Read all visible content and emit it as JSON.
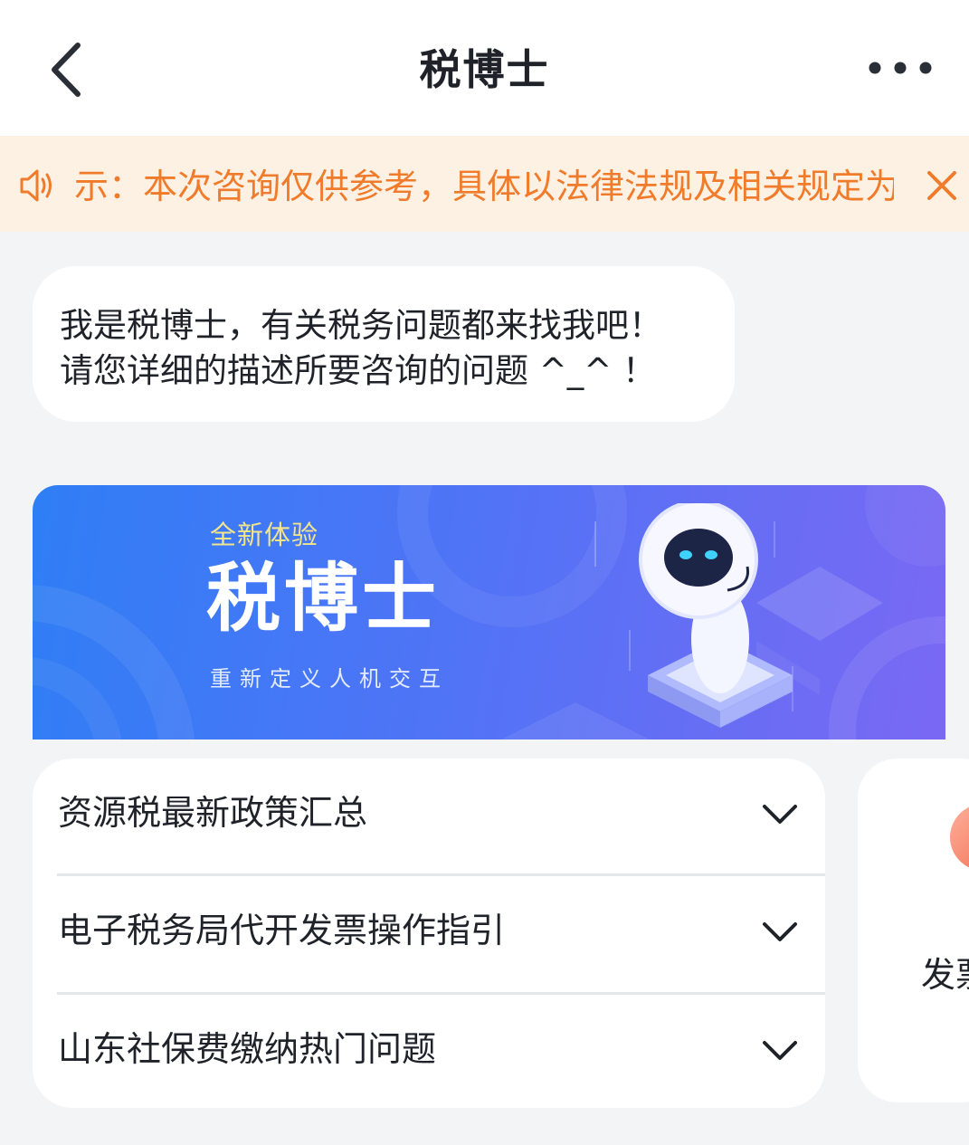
{
  "header": {
    "title": "税博士",
    "back_icon": "chevron-left-icon",
    "more_icon": "more-horizontal-icon"
  },
  "notice": {
    "icon": "speaker-icon",
    "text": "示：本次咨询仅供参考，具体以法律法规及相关规定为准",
    "close_icon": "close-icon",
    "color": "#f07b2b"
  },
  "chat": {
    "welcome_line1": "我是税博士，有关税务问题都来找我吧！",
    "welcome_line2": "请您详细的描述所要咨询的问题 ^_^ ！"
  },
  "banner": {
    "subtitle": "全新体验",
    "title": "税博士",
    "slogan": "重新定义人机交互"
  },
  "faq": {
    "items": [
      {
        "label": "资源税最新政策汇总"
      },
      {
        "label": "电子税务局代开发票操作指引"
      },
      {
        "label": "山东社保费缴纳热门问题"
      }
    ]
  },
  "side_card": {
    "label": "发票"
  }
}
